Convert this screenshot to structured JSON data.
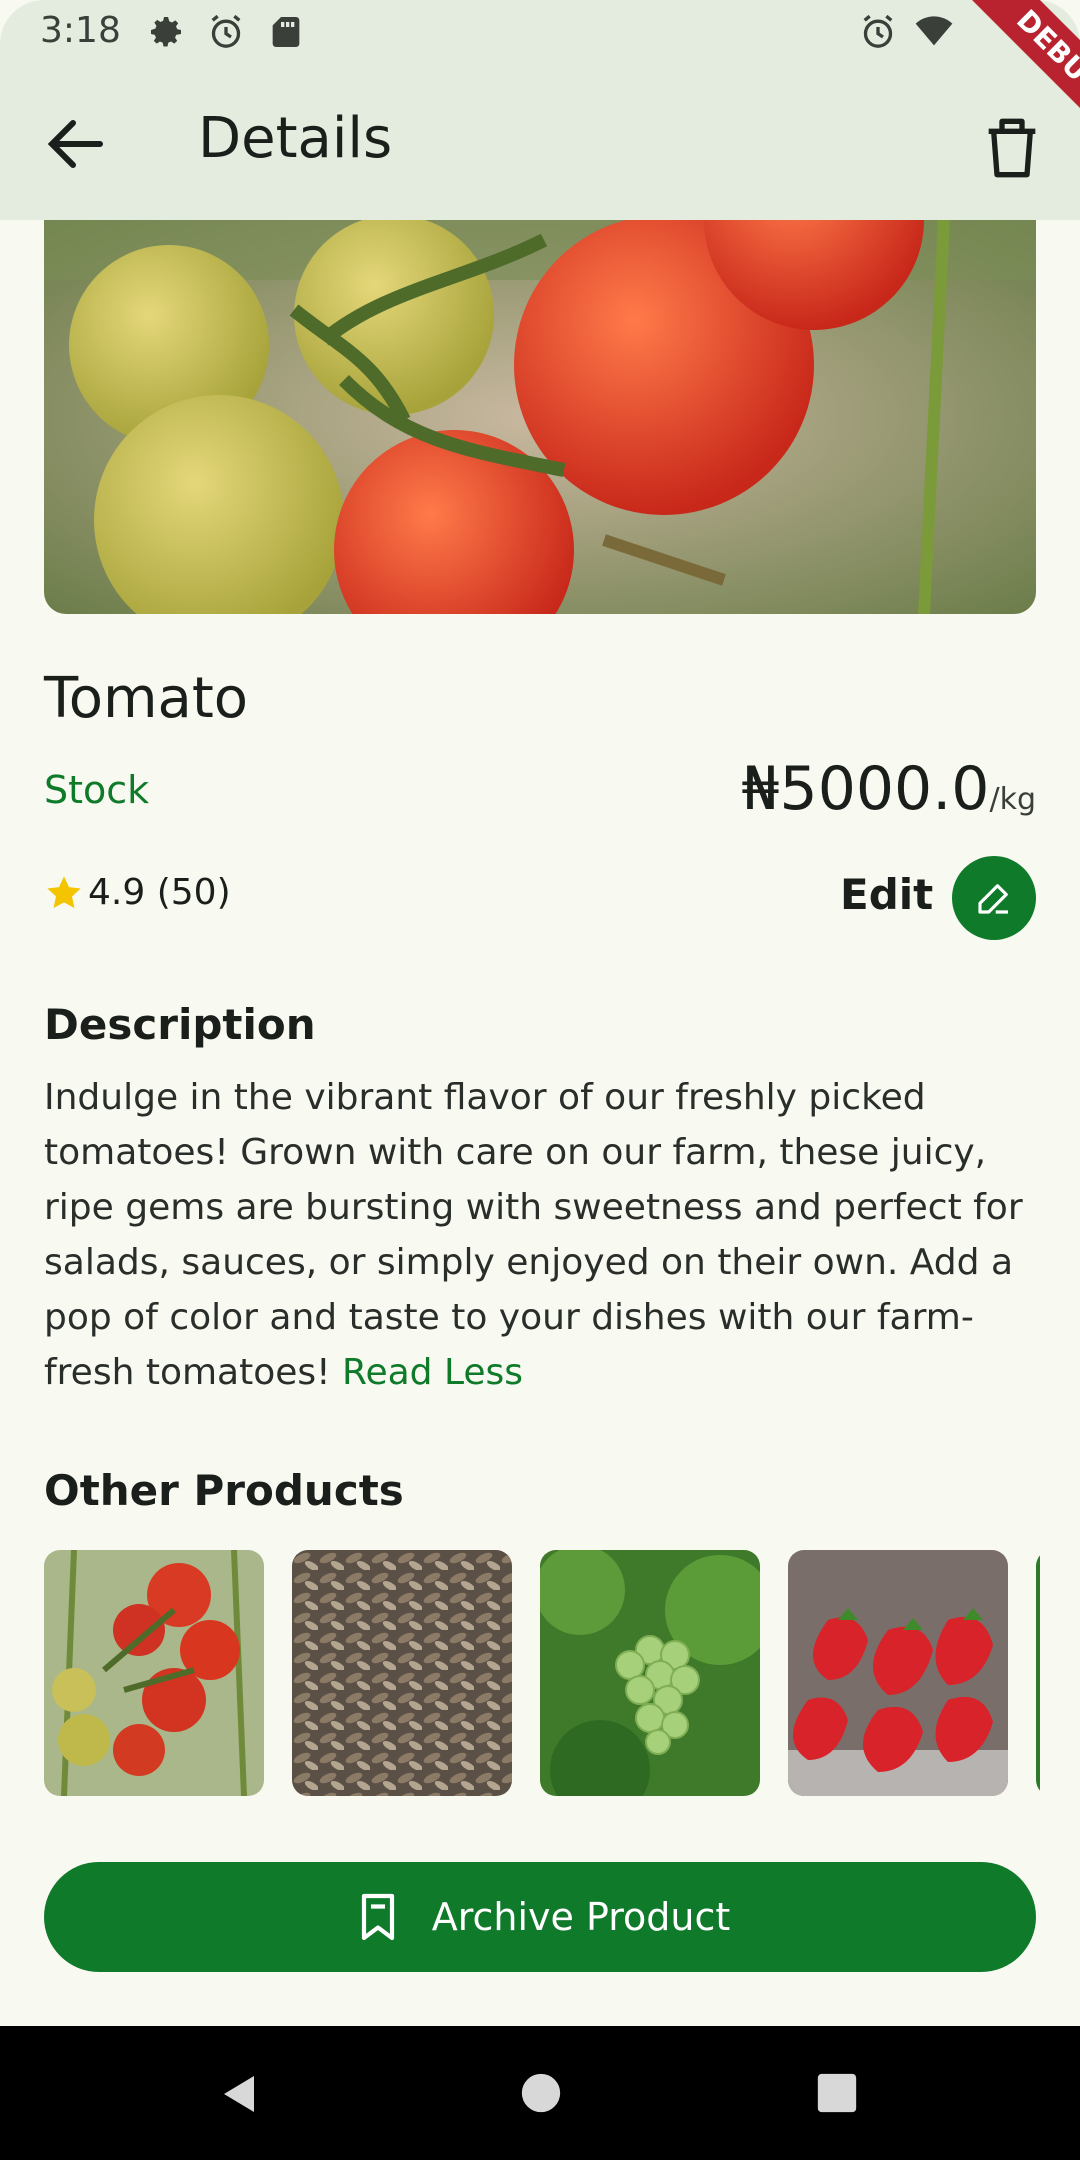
{
  "status_bar": {
    "time": "3:18"
  },
  "app_bar": {
    "title": "Details",
    "debug_label": "DEBUG"
  },
  "product": {
    "name": "Tomato",
    "stock_label": "Stock",
    "price": "₦5000.0",
    "unit": "/kg",
    "rating_value": "4.9",
    "rating_count": "(50)",
    "edit_label": "Edit"
  },
  "description": {
    "title": "Description",
    "text": "Indulge in the vibrant flavor of our freshly picked tomatoes! Grown with care on our farm, these juicy, ripe gems are bursting with sweetness and perfect for salads, sauces, or simply enjoyed on their own. Add a pop of color and taste to your dishes with our farm-fresh tomatoes! ",
    "read_less": "Read Less"
  },
  "other_products": {
    "title": "Other Products",
    "items": [
      {
        "icon": "tomatoes-image"
      },
      {
        "icon": "seeds-image"
      },
      {
        "icon": "grapes-image"
      },
      {
        "icon": "strawberries-image"
      },
      {
        "icon": "product-image"
      }
    ]
  },
  "archive_button": {
    "label": "Archive Product"
  },
  "colors": {
    "primary": "#0f7a2a",
    "background": "#f8faf2",
    "appbar": "#e4ecdf"
  }
}
